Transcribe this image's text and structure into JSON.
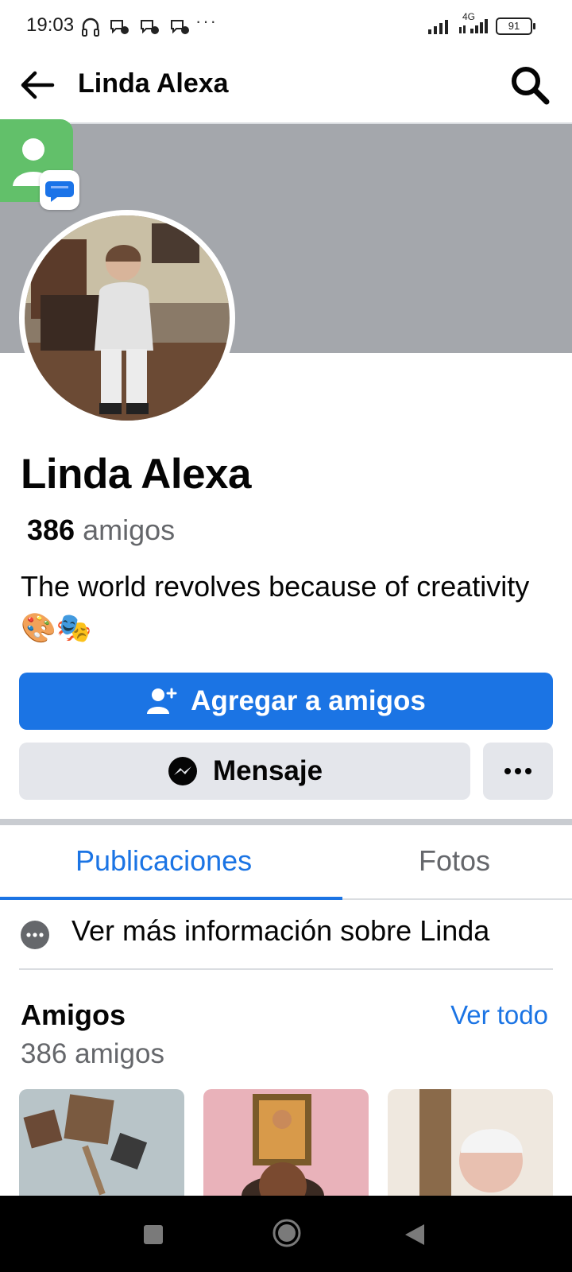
{
  "status_bar": {
    "time": "19:03",
    "network": "4G",
    "battery": "91"
  },
  "header": {
    "title": "Linda Alexa"
  },
  "profile": {
    "name": "Linda Alexa",
    "friends_count": "386",
    "friends_word": "amigos",
    "bio": "The world revolves because of creativity🎨🎭"
  },
  "actions": {
    "add_friend": "Agregar a amigos",
    "message": "Mensaje"
  },
  "tabs": [
    {
      "label": "Publicaciones",
      "active": true
    },
    {
      "label": "Fotos",
      "active": false
    }
  ],
  "info": {
    "text": "Ver más información sobre Linda"
  },
  "friends_section": {
    "title": "Amigos",
    "see_all": "Ver todo",
    "count_text": "386 amigos"
  },
  "colors": {
    "accent": "#1b74e4",
    "cover": "#a4a7ac",
    "secondary_button": "#e4e6eb",
    "muted_text": "#65676b"
  }
}
